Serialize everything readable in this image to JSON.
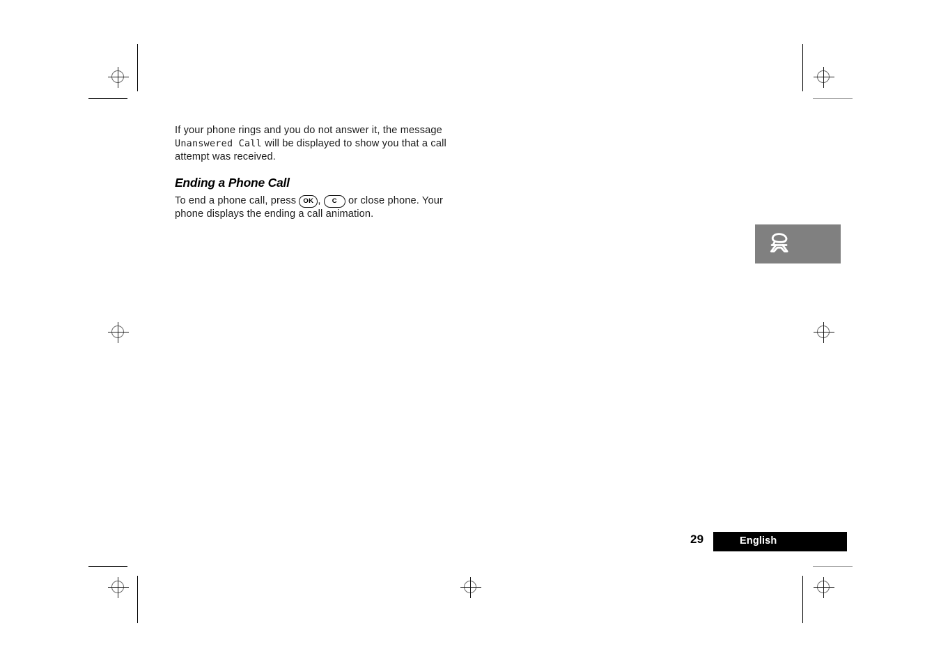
{
  "page": {
    "number": "29",
    "language": "English"
  },
  "content": {
    "intro": {
      "before_lcd": "If your phone rings and you do not answer it, the message ",
      "lcd_text": "Unanswered Call",
      "after_lcd": " will be displayed to show you that a call attempt was received."
    },
    "heading": "Ending a Phone Call",
    "instruction": {
      "before_keys": "To end a phone call, press ",
      "key_ok": "OK",
      "key_separator": ", ",
      "key_c": "C",
      "after_keys": " or close phone. Your phone displays the ending a call animation."
    }
  },
  "chapter_tab": {
    "icon": "telephone-icon",
    "background_color": "#808080",
    "icon_color": "#ffffff"
  },
  "print_marks": {
    "registration_icon": "registration-target-icon",
    "crop_mark_color": "#000000",
    "crop_mark_color_light": "#9a9a9a"
  }
}
